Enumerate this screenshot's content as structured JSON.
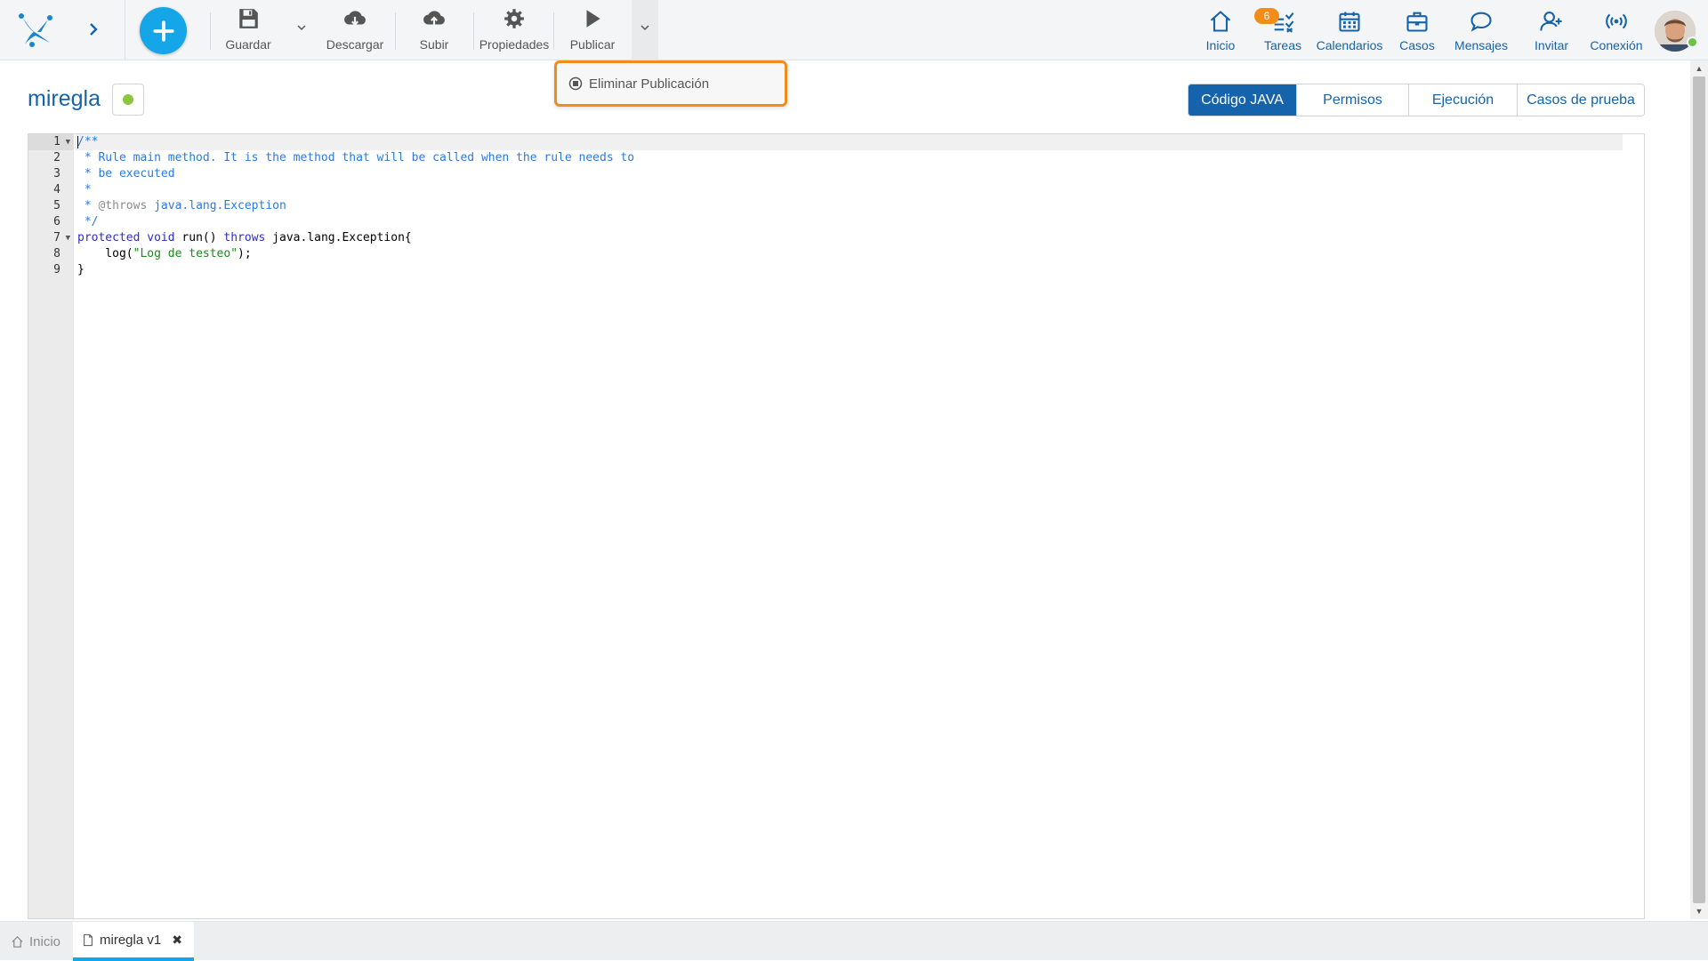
{
  "toolbar": {
    "guardar": "Guardar",
    "descargar": "Descargar",
    "subir": "Subir",
    "propiedades": "Propiedades",
    "publicar": "Publicar"
  },
  "dropdown": {
    "eliminar_publicacion": "Eliminar Publicación"
  },
  "nav": {
    "inicio": "Inicio",
    "tareas": "Tareas",
    "tareas_badge": "6",
    "calendarios": "Calendarios",
    "casos": "Casos",
    "mensajes": "Mensajes",
    "invitar": "Invitar",
    "conexion": "Conexión"
  },
  "rule": {
    "title": "miregla",
    "status_color": "#8cc63f"
  },
  "tabs": [
    {
      "label": "Código JAVA",
      "active": true
    },
    {
      "label": "Permisos",
      "active": false
    },
    {
      "label": "Ejecución",
      "active": false
    },
    {
      "label": "Casos de prueba",
      "active": false
    }
  ],
  "editor": {
    "line_numbers": [
      "1",
      "2",
      "3",
      "4",
      "5",
      "6",
      "7",
      "8",
      "9"
    ],
    "lines": {
      "l1": "/**",
      "l2": " * Rule main method. It is the method that will be called when the rule needs to",
      "l3": " * be executed",
      "l4": " *",
      "l5_a": " * ",
      "l5_b": "@throws",
      "l5_c": " java.lang.Exception",
      "l6": " */",
      "l7_kw1": "protected",
      "l7_kw2": "void",
      "l7_a": " run() ",
      "l7_kw3": "throws",
      "l7_b": " java.lang.Exception{",
      "l8_a": "    log(",
      "l8_str": "\"Log de testeo\"",
      "l8_b": ");",
      "l9": "}"
    }
  },
  "bottom_tabs": {
    "home": "Inicio",
    "doc": "miregla v1"
  },
  "colors": {
    "brand_blue": "#1563ab",
    "add_button": "#14a6e9",
    "highlight_orange": "#f08b1c",
    "badge_orange": "#f28c1b"
  }
}
